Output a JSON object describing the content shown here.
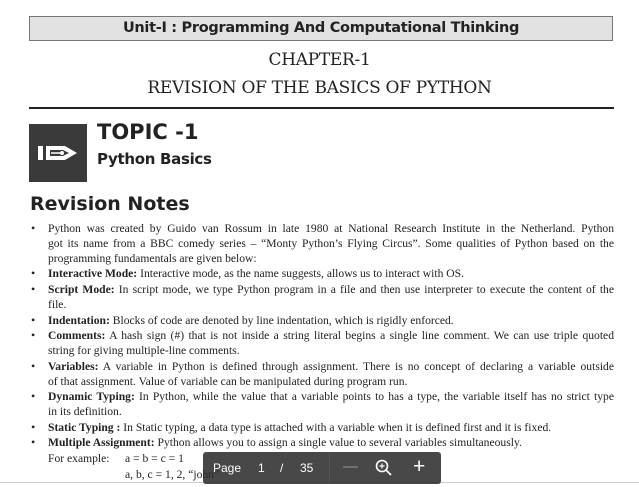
{
  "unit_header": "Unit-I : Programming And Computational Thinking",
  "chapter": "CHAPTER-1",
  "chapter_title": "REVISION OF THE BASICS OF PYTHON",
  "topic": {
    "title": "TOPIC -1",
    "subtitle": "Python Basics",
    "icon": "pen-nib-icon"
  },
  "notes_heading": "Revision Notes",
  "notes": {
    "intro": [
      "Python was created by Guido van Rossum in late 1980 at National Research Institute in the Netherland. Python",
      "got its name from a BBC comedy series – “Monty Python’s Flying Circus”. Some qualities of Python based on the",
      "programming fundamentals are given below:"
    ],
    "interactive": {
      "term": "Interactive Mode:",
      "text": " Interactive mode, as the name suggests, allows us to interact with OS."
    },
    "script": {
      "term": "Script Mode:",
      "text": " In script mode, we type Python program in a file and then use interpreter to execute the content of the",
      "cont": "file."
    },
    "indentation": {
      "term": "Indentation:",
      "text": " Blocks of code are denoted by line indentation, which is rigidly enforced."
    },
    "comments": {
      "term": "Comments:",
      "text": " A hash sign (#) that is not inside a string literal begins a single line comment. We can use triple quoted",
      "cont": "string for giving multiple-line comments."
    },
    "variables": {
      "term": "Variables:",
      "text": " A variable in Python is defined through assignment. There is no concept of declaring a variable outside",
      "cont": "of that assignment. Value of variable can be manipulated during program run."
    },
    "dynamic": {
      "term": "Dynamic Typing:",
      "text": " In Python, while the value that a variable points to has a type, the variable itself has no strict type",
      "cont": "in its definition."
    },
    "static": {
      "term": "Static Typing :",
      "text": " In Static typing, a data type is attached with a variable when it is defined first and it is fixed."
    },
    "multiple": {
      "term": "Multiple Assignment:",
      "text": " Python allows you to assign a single value to several variables simultaneously."
    },
    "example_label": "For example:",
    "example_lines": [
      "a = b = c = 1",
      "a, b, c = 1, 2, “john”"
    ]
  },
  "toolbar": {
    "page_label": "Page",
    "current_page": "1",
    "separator": "/",
    "total_pages": "35",
    "zoom_out": "—",
    "zoom_in": "+"
  }
}
